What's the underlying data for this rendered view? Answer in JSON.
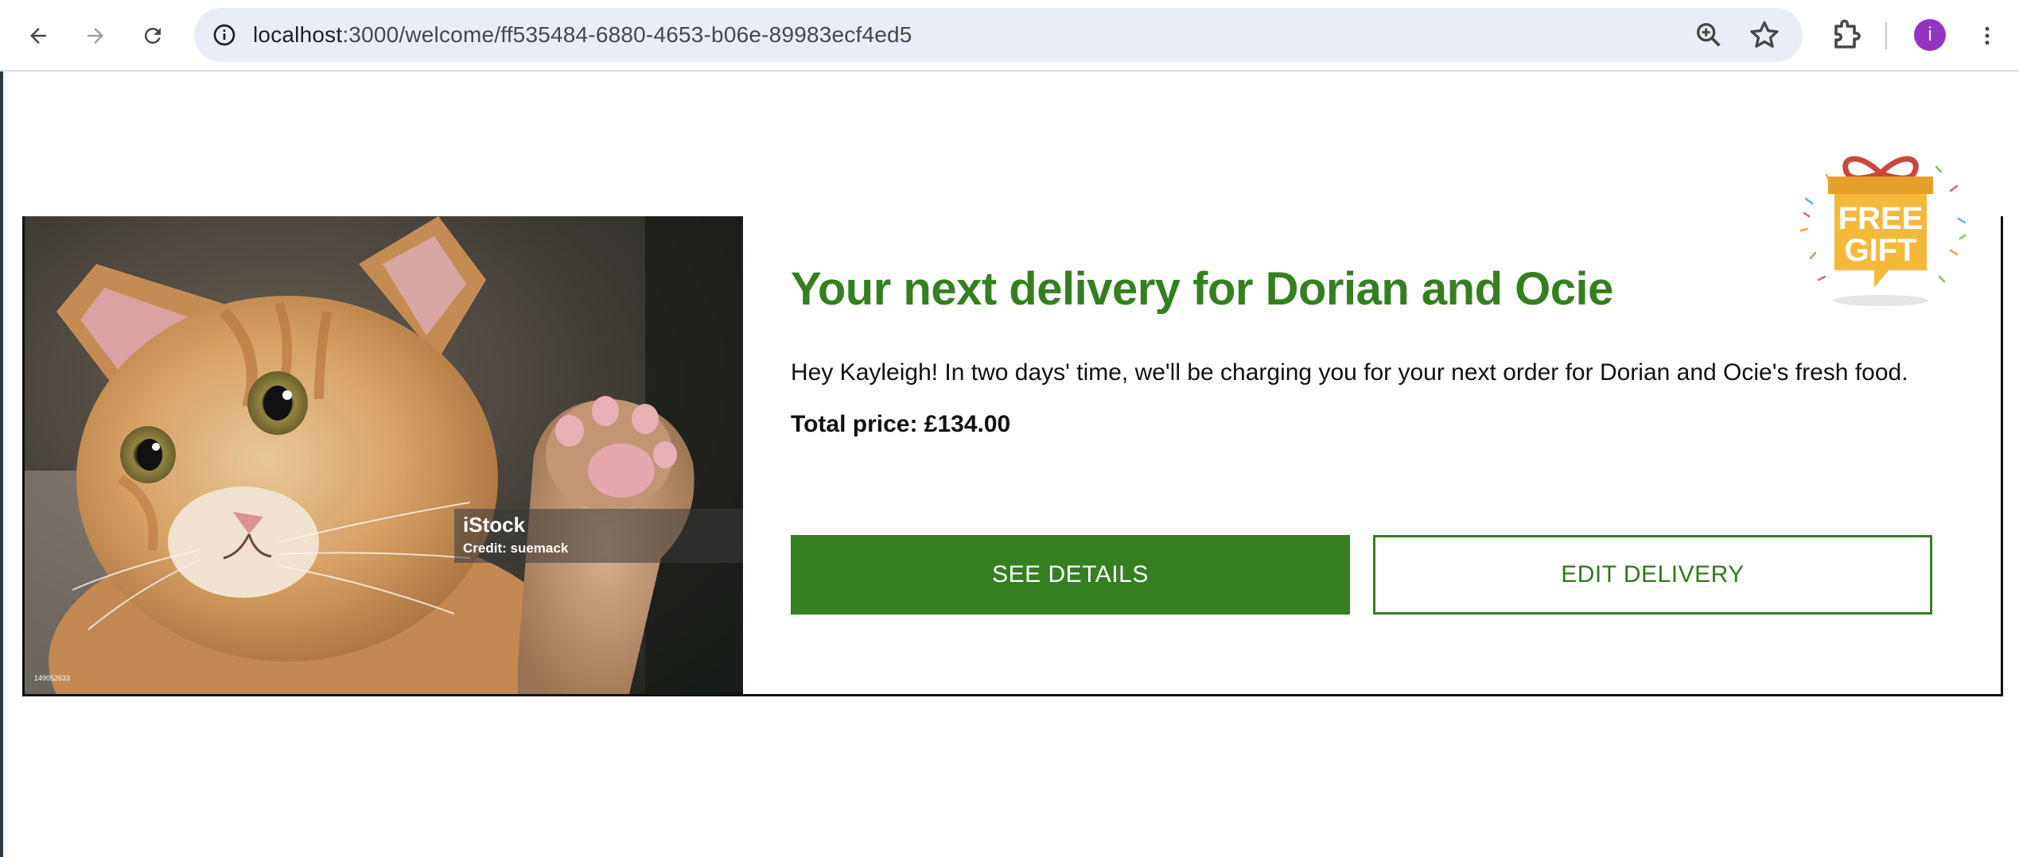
{
  "browser": {
    "url_host": "localhost",
    "url_path": ":3000/welcome/ff535484-6880-4653-b06e-89983ecf4ed5",
    "profile_initial": "i",
    "icons": {
      "back": "arrow-left-icon",
      "forward": "arrow-right-icon",
      "reload": "reload-icon",
      "site_info": "info-circle-icon",
      "zoom": "zoom-in-icon",
      "bookmark": "star-icon",
      "extensions": "puzzle-icon",
      "menu": "more-vertical-icon"
    }
  },
  "delivery_card": {
    "title": "Your next delivery for Dorian and Ocie",
    "message": "Hey Kayleigh! In two days' time, we'll be charging you for your next order for Dorian and Ocie's fresh food.",
    "price": "Total price: £134.00",
    "see_details_label": "SEE DETAILS",
    "edit_delivery_label": "EDIT DELIVERY",
    "image": {
      "watermark_brand": "iStock",
      "watermark_credit": "Credit: suemack",
      "stock_id": "149052633",
      "alt": "Kitten raising paw"
    }
  },
  "gift_badge": {
    "line1": "FREE",
    "line2": "GIFT"
  },
  "colors": {
    "brand_green": "#34801f",
    "button_green": "#357f21",
    "avatar_purple": "#9334c2",
    "gift_yellow": "#f5b93a",
    "gift_ribbon": "#c8483d"
  }
}
